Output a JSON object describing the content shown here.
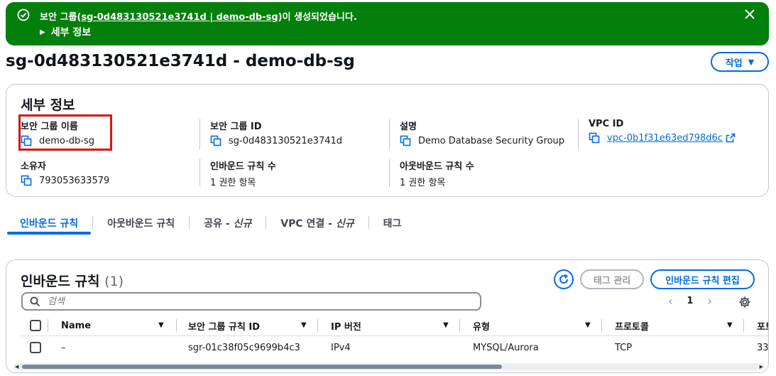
{
  "flash": {
    "message_prefix": "보안 그룹(",
    "message_link": "sg-0d483130521e3741d | demo-db-sg",
    "message_suffix": ")이 생성되었습니다.",
    "details_toggle": "세부 정보",
    "color": "#037f0c"
  },
  "page": {
    "title": "sg-0d483130521e3741d - demo-db-sg",
    "actions_label": "작업"
  },
  "details": {
    "heading": "세부 정보",
    "fields": {
      "sg_name": {
        "label": "보안 그룹 이름",
        "value": "demo-db-sg"
      },
      "sg_id": {
        "label": "보안 그룹 ID",
        "value": "sg-0d483130521e3741d"
      },
      "description": {
        "label": "설명",
        "value": "Demo Database Security Group"
      },
      "vpc_id": {
        "label": "VPC ID",
        "value": "vpc-0b1f31e63ed798d6c"
      },
      "owner": {
        "label": "소유자",
        "value": "793053633579"
      },
      "inbound_count": {
        "label": "인바운드 규칙 수",
        "value": "1 권한 항목"
      },
      "outbound_count": {
        "label": "아웃바운드 규칙 수",
        "value": "1 권한 항목"
      }
    }
  },
  "tabs": [
    {
      "label": "인바운드 규칙",
      "active": true
    },
    {
      "label": "아웃바운드 규칙",
      "active": false
    },
    {
      "label": "공유 - ",
      "badge": "신규",
      "active": false
    },
    {
      "label": "VPC 연결 - ",
      "badge": "신규",
      "active": false
    },
    {
      "label": "태그",
      "active": false
    }
  ],
  "rules": {
    "heading": "인바운드 규칙",
    "count": "(1)",
    "manage_tags_label": "태그 관리",
    "edit_label": "인바운드 규칙 편집",
    "search_placeholder": "검색",
    "page": "1",
    "columns": [
      "Name",
      "보안 그룹 규칙 ID",
      "IP 버전",
      "유형",
      "프로토콜",
      "포트"
    ],
    "rows": [
      {
        "name": "–",
        "rule_id": "sgr-01c38f05c9699b4c3",
        "ip_version": "IPv4",
        "type": "MYSQL/Aurora",
        "protocol": "TCP",
        "port": "33"
      }
    ]
  },
  "colors": {
    "accent": "#006ce0",
    "highlight": "#d91515"
  }
}
